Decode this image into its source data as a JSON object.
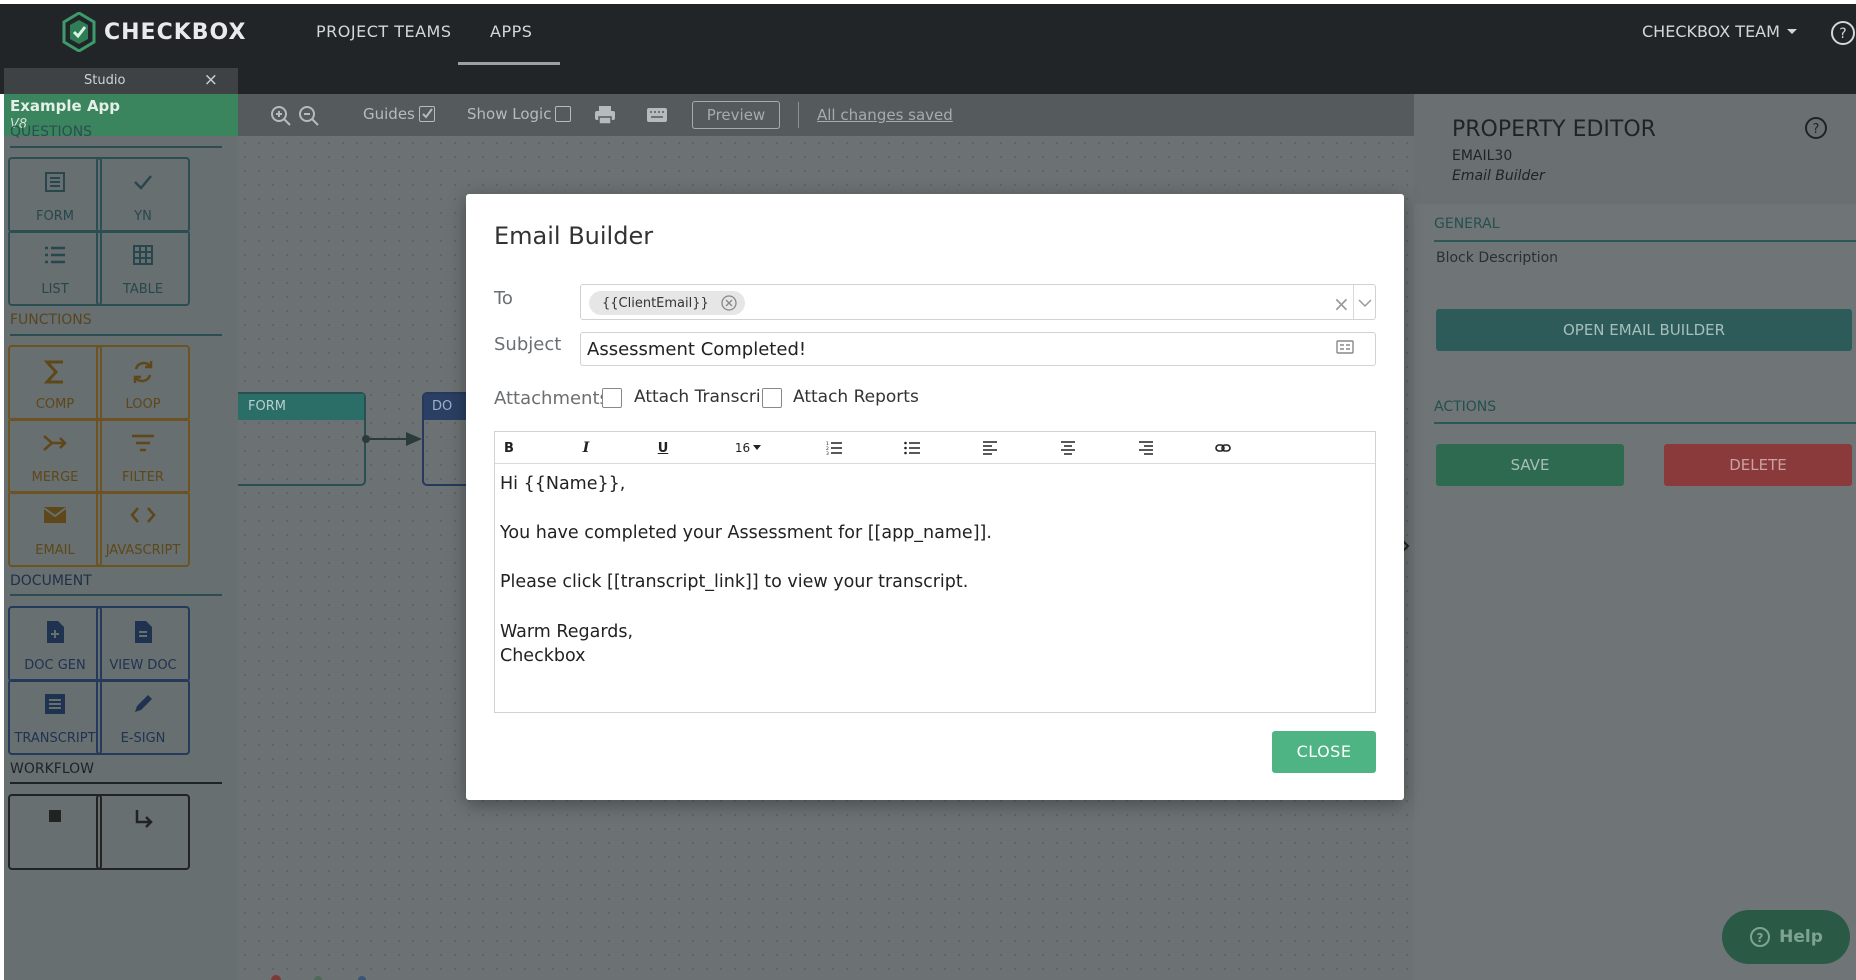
{
  "app": {
    "brand": "CHECKBOX"
  },
  "nav": {
    "project_teams": "PROJECT TEAMS",
    "apps": "APPS",
    "team_menu": "CHECKBOX TEAM"
  },
  "studio_tab": {
    "label": "Studio",
    "close": "×"
  },
  "sidebar": {
    "app_name": "Example App",
    "app_version": "V8",
    "questions": {
      "title": "QUESTIONS",
      "blocks": [
        "FORM",
        "YN",
        "LIST",
        "TABLE"
      ]
    },
    "functions": {
      "title": "FUNCTIONS",
      "blocks": [
        "COMP",
        "LOOP",
        "MERGE",
        "FILTER",
        "EMAIL",
        "JAVASCRIPT"
      ]
    },
    "document": {
      "title": "DOCUMENT",
      "blocks": [
        "DOC GEN",
        "VIEW DOC",
        "TRANSCRIPT",
        "E-SIGN"
      ]
    },
    "workflow": {
      "title": "WORKFLOW"
    }
  },
  "toolbar": {
    "guides": "Guides",
    "guides_checked": true,
    "show_logic": "Show Logic",
    "show_logic_checked": false,
    "preview": "Preview",
    "status": "All changes saved"
  },
  "canvas": {
    "form_node": "FORM",
    "doc_node": "DO"
  },
  "property_editor": {
    "title": "PROPERTY EDITOR",
    "block_id": "EMAIL30",
    "block_type": "Email Builder",
    "general": "GENERAL",
    "block_description": "Block Description",
    "open_email_builder": "OPEN EMAIL BUILDER",
    "actions": "ACTIONS",
    "save": "SAVE",
    "delete": "DELETE",
    "help": "Help"
  },
  "modal": {
    "title": "Email Builder",
    "to_label": "To",
    "to_chip": "{{ClientEmail}}",
    "subject_label": "Subject",
    "subject_value": "Assessment Completed!",
    "attachments_label": "Attachments",
    "attach_transcript": "Attach Transcript",
    "attach_transcript_checked": false,
    "attach_reports": "Attach Reports",
    "attach_reports_checked": false,
    "font_size": "16",
    "body_lines": [
      "Hi {{Name}},",
      "",
      "You have completed your Assessment for [[app_name]].",
      "",
      "Please click [[transcript_link]] to view your transcript.",
      "",
      "Warm Regards,",
      "Checkbox"
    ],
    "close": "CLOSE"
  },
  "colors": {
    "topbar": "#222527",
    "app_header": "#3a855d",
    "close_button": "#4fb483",
    "delete_button": "#8a3a3a",
    "save_button": "#2d6a4f"
  }
}
